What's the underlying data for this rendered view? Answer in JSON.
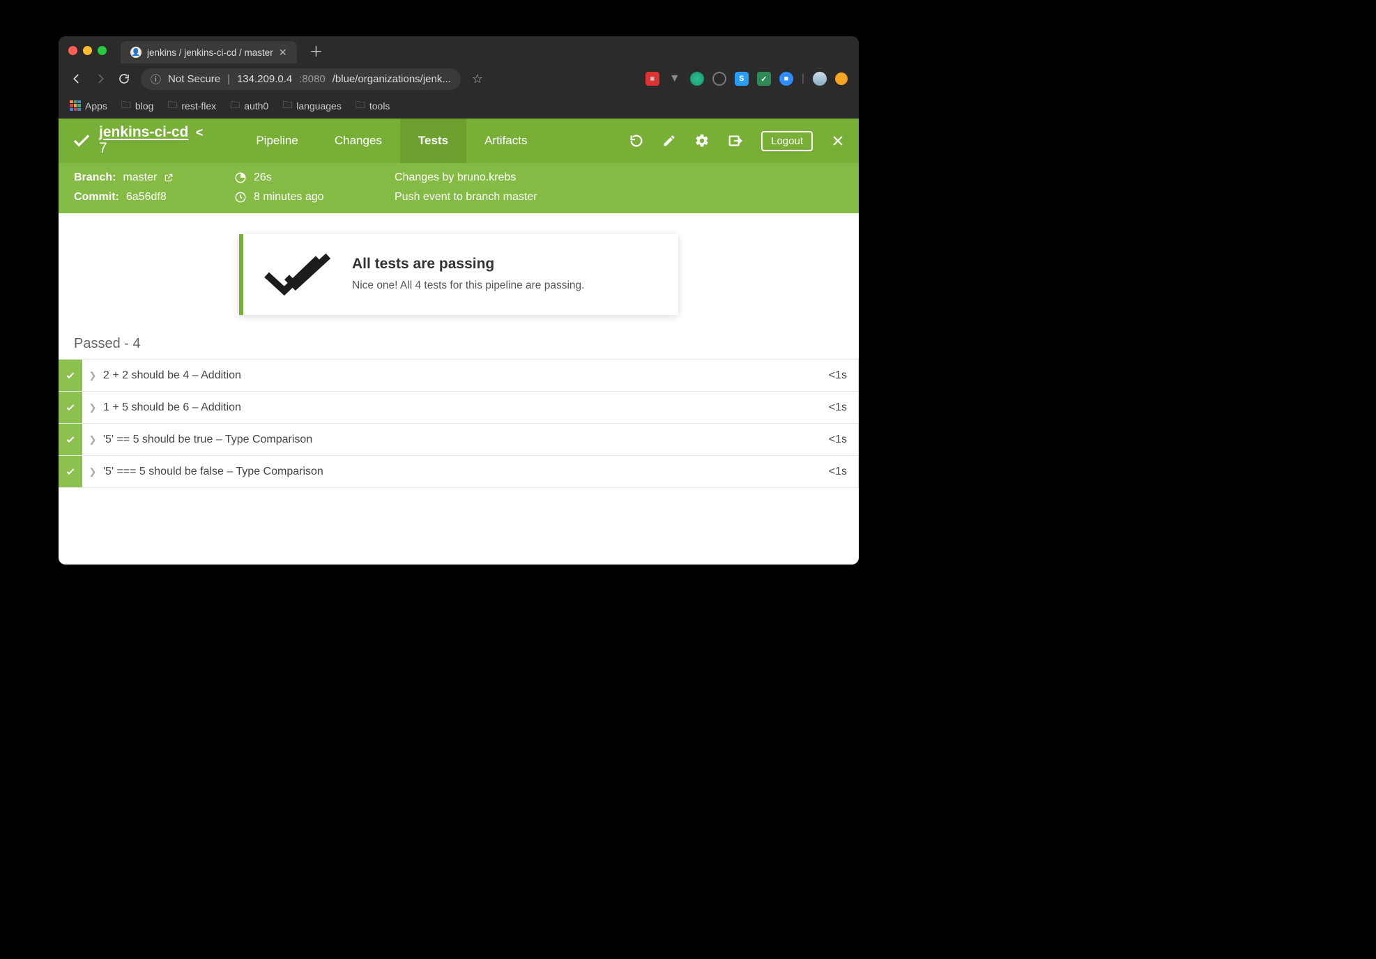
{
  "browser": {
    "tab_title": "jenkins / jenkins-ci-cd / master",
    "url_insecure_label": "Not Secure",
    "url_host": "134.209.0.4",
    "url_port": ":8080",
    "url_path": "/blue/organizations/jenk...",
    "bookmarks_bar": {
      "apps_label": "Apps",
      "items": [
        "blog",
        "rest-flex",
        "auth0",
        "languages",
        "tools"
      ]
    }
  },
  "header": {
    "pipeline_name": "jenkins-ci-cd",
    "run_number": "7",
    "tabs": [
      {
        "label": "Pipeline",
        "active": false
      },
      {
        "label": "Changes",
        "active": false
      },
      {
        "label": "Tests",
        "active": true
      },
      {
        "label": "Artifacts",
        "active": false
      }
    ],
    "logout_label": "Logout",
    "meta": {
      "branch_label": "Branch:",
      "branch_value": "master",
      "commit_label": "Commit:",
      "commit_value": "6a56df8",
      "duration": "26s",
      "completed": "8 minutes ago",
      "changes_by": "Changes by bruno.krebs",
      "cause": "Push event to branch master"
    }
  },
  "content": {
    "summary_title": "All tests are passing",
    "summary_sub": "Nice one! All 4 tests for this pipeline are passing.",
    "section_title": "Passed - 4",
    "tests": [
      {
        "name": "2 + 2 should be 4 – Addition",
        "duration": "<1s"
      },
      {
        "name": "1 + 5 should be 6 – Addition",
        "duration": "<1s"
      },
      {
        "name": "'5' == 5 should be true – Type Comparison",
        "duration": "<1s"
      },
      {
        "name": "'5' === 5 should be false – Type Comparison",
        "duration": "<1s"
      }
    ]
  }
}
